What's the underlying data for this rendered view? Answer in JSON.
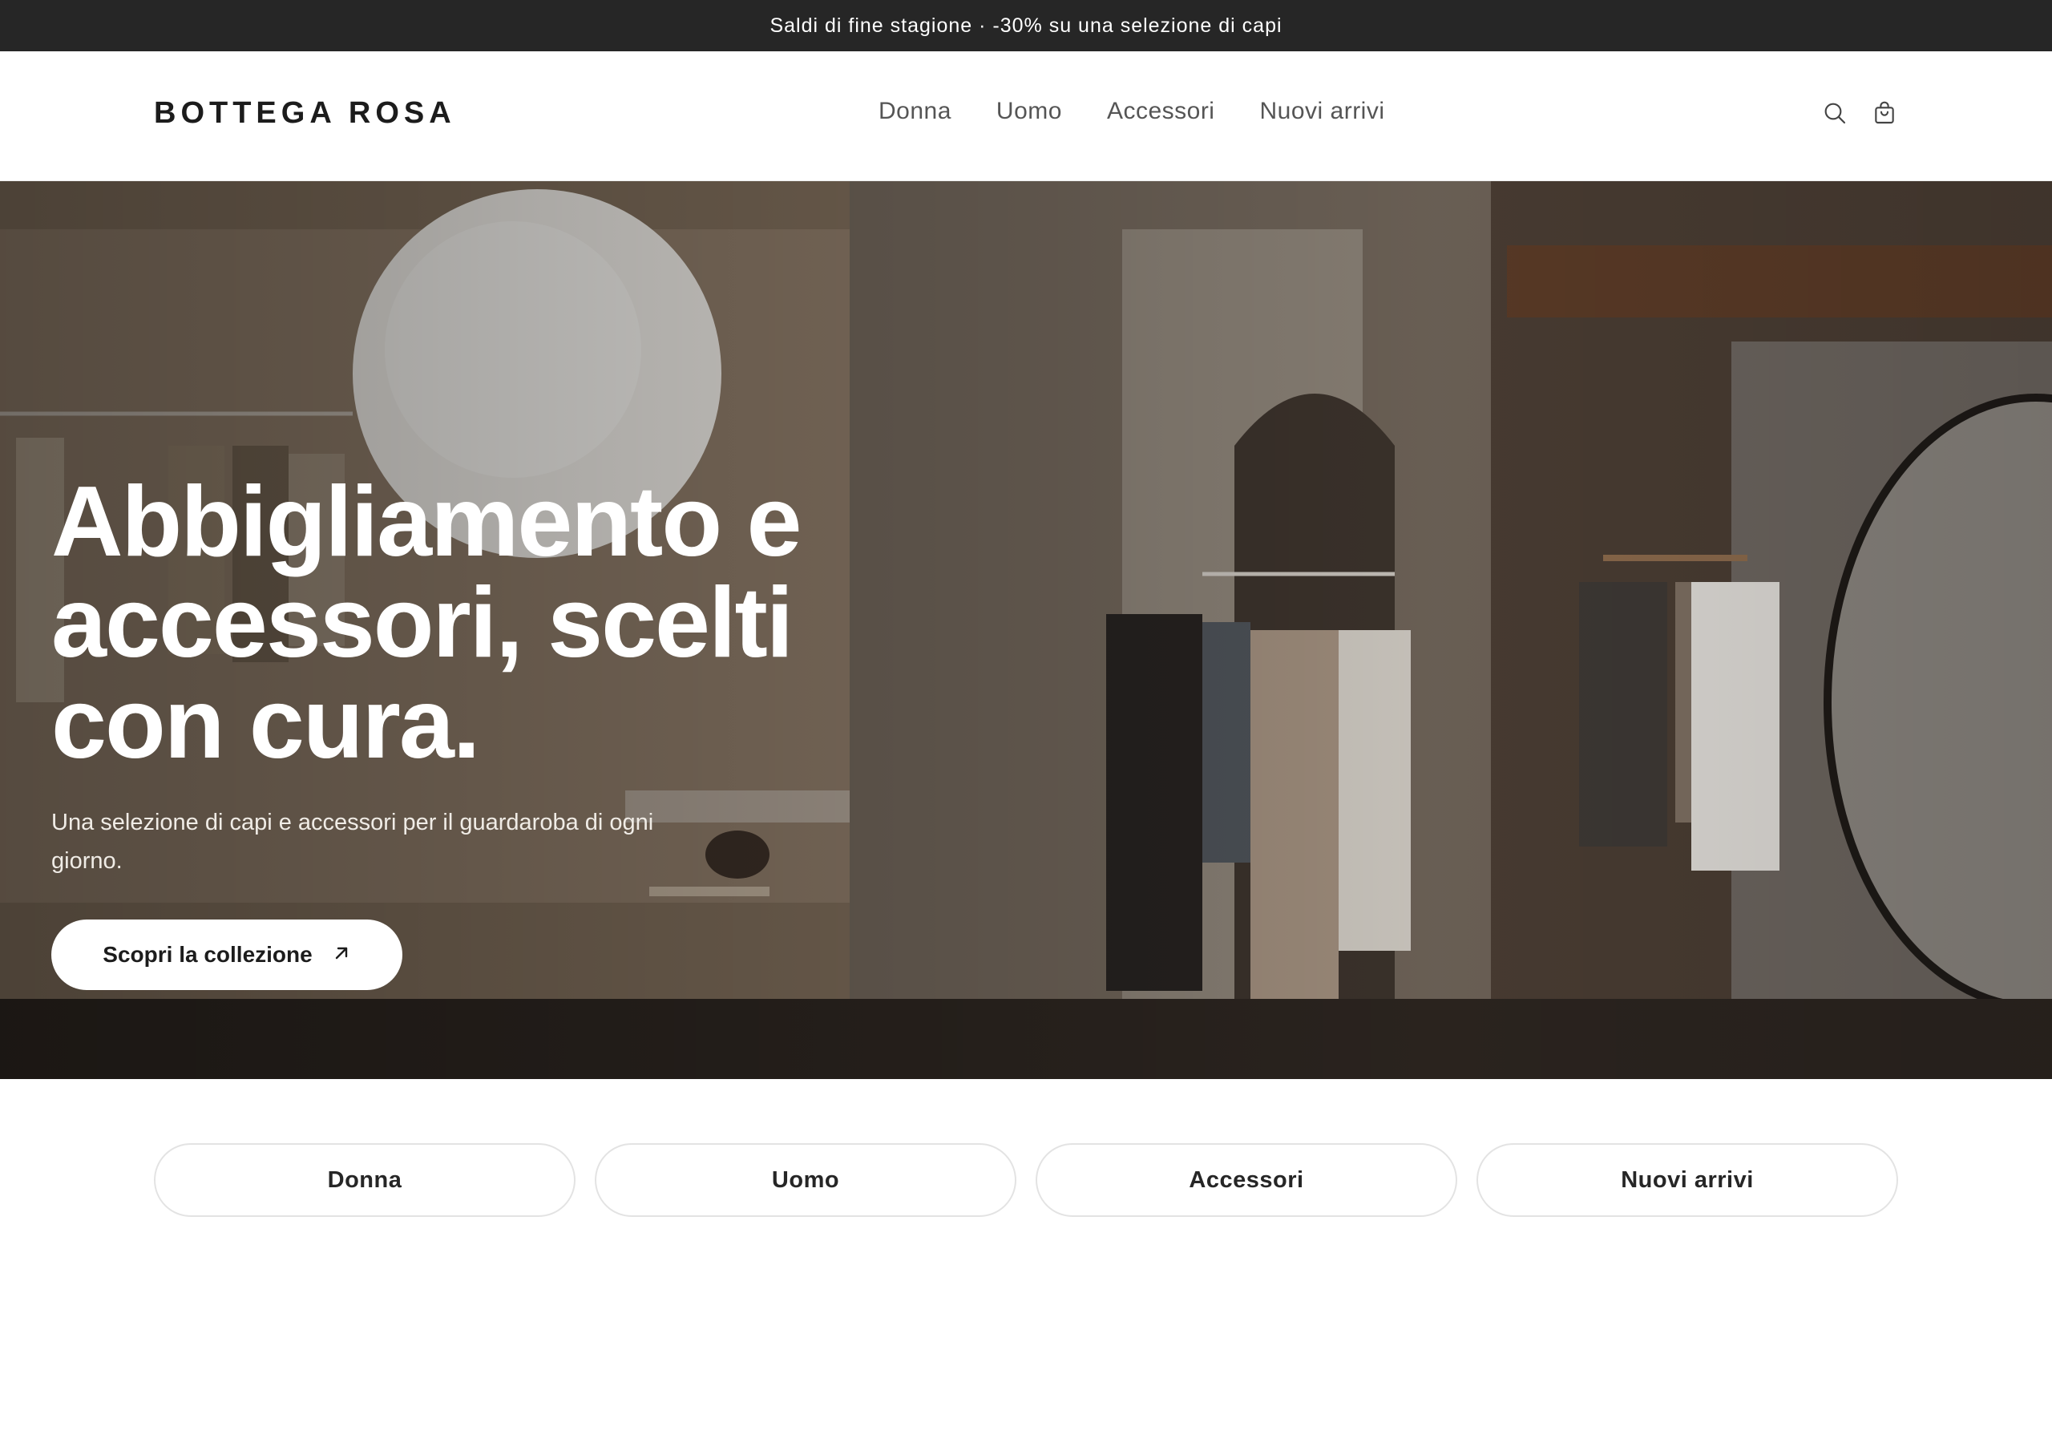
{
  "announcement": {
    "text": "Saldi di fine stagione · -30% su una selezione di capi"
  },
  "header": {
    "logo": "BOTTEGA ROSA",
    "nav": [
      "Donna",
      "Uomo",
      "Accessori",
      "Nuovi arrivi"
    ],
    "icons": [
      "search-icon",
      "shopping-bag-icon"
    ]
  },
  "hero": {
    "title_lines": [
      "Abbigliamento e",
      "accessori, scelti",
      "con cura."
    ],
    "subtitle": "Una selezione di capi e accessori per il guardaroba di ogni giorno.",
    "cta_label": "Scopri la collezione",
    "cta_icon": "arrow-up-right-icon"
  },
  "categories": [
    "Donna",
    "Uomo",
    "Accessori",
    "Nuovi arrivi"
  ],
  "colors": {
    "announcement_bg": "#262626",
    "text_dark": "#1c1c1c",
    "nav_text": "#555555",
    "pill_border": "#e3e3e3"
  }
}
